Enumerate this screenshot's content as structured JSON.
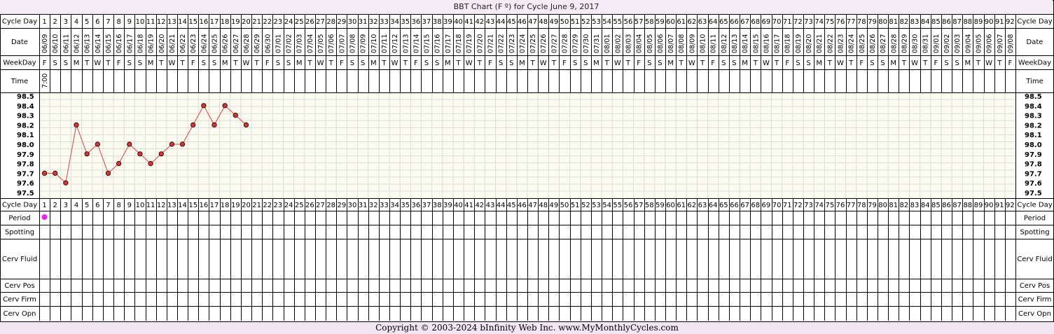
{
  "title": "BBT Chart (F º) for Cycle June 9, 2017",
  "row_labels": {
    "cycle_day": "Cycle Day",
    "date": "Date",
    "weekday": "WeekDay",
    "time": "Time",
    "period": "Period",
    "spotting": "Spotting",
    "cerv_fluid": "Cerv Fluid",
    "cerv_pos": "Cerv Pos",
    "cerv_firm": "Cerv Firm",
    "cerv_opn": "Cerv Opn"
  },
  "days": [
    "1",
    "2",
    "3",
    "4",
    "5",
    "6",
    "7",
    "8",
    "9",
    "10",
    "11",
    "12",
    "13",
    "14",
    "15",
    "16",
    "17",
    "18",
    "19",
    "20",
    "21",
    "22",
    "23",
    "24",
    "25",
    "26",
    "27",
    "28",
    "29",
    "30",
    "31",
    "32",
    "33",
    "34",
    "35",
    "36",
    "37",
    "38",
    "39",
    "40",
    "41",
    "42",
    "43",
    "44",
    "45",
    "46",
    "47",
    "48",
    "49",
    "50",
    "51",
    "52",
    "53",
    "54",
    "55",
    "56",
    "57",
    "58",
    "59",
    "60",
    "61",
    "62",
    "63",
    "64",
    "65",
    "66",
    "67",
    "68",
    "69",
    "70",
    "71",
    "72",
    "73",
    "74",
    "75",
    "76",
    "77",
    "78",
    "79",
    "80",
    "81",
    "82",
    "83",
    "84",
    "85",
    "86",
    "87",
    "88",
    "89",
    "90",
    "91",
    "92"
  ],
  "dates": [
    "06/09",
    "06/10",
    "06/11",
    "06/12",
    "06/13",
    "06/14",
    "06/15",
    "06/16",
    "06/17",
    "06/18",
    "06/19",
    "06/20",
    "06/21",
    "06/22",
    "06/23",
    "06/24",
    "06/25",
    "06/26",
    "06/27",
    "06/28",
    "06/29",
    "06/30",
    "07/01",
    "07/02",
    "07/03",
    "07/04",
    "07/05",
    "07/06",
    "07/07",
    "07/08",
    "07/09",
    "07/10",
    "07/11",
    "07/12",
    "07/13",
    "07/14",
    "07/15",
    "07/16",
    "07/17",
    "07/18",
    "07/19",
    "07/20",
    "07/21",
    "07/22",
    "07/23",
    "07/24",
    "07/25",
    "07/26",
    "07/27",
    "07/28",
    "07/29",
    "07/30",
    "07/31",
    "08/01",
    "08/02",
    "08/03",
    "08/04",
    "08/05",
    "08/06",
    "08/07",
    "08/08",
    "08/09",
    "08/10",
    "08/11",
    "08/12",
    "08/13",
    "08/14",
    "08/15",
    "08/16",
    "08/17",
    "08/18",
    "08/19",
    "08/20",
    "08/21",
    "08/22",
    "08/23",
    "08/24",
    "08/25",
    "08/26",
    "08/27",
    "08/28",
    "08/29",
    "08/30",
    "08/31",
    "09/01",
    "09/02",
    "09/03",
    "09/04",
    "09/05",
    "09/06",
    "09/07",
    "09/08"
  ],
  "weekdays": [
    "F",
    "S",
    "S",
    "M",
    "T",
    "W",
    "T",
    "F",
    "S",
    "S",
    "M",
    "T",
    "W",
    "T",
    "F",
    "S",
    "S",
    "M",
    "T",
    "W",
    "T",
    "F",
    "S",
    "S",
    "M",
    "T",
    "W",
    "T",
    "F",
    "S",
    "S",
    "M",
    "T",
    "W",
    "T",
    "F",
    "S",
    "S",
    "M",
    "T",
    "W",
    "T",
    "F",
    "S",
    "S",
    "M",
    "T",
    "W",
    "T",
    "F",
    "S",
    "S",
    "M",
    "T",
    "W",
    "T",
    "F",
    "S",
    "S",
    "M",
    "T",
    "W",
    "T",
    "F",
    "S",
    "S",
    "M",
    "T",
    "W",
    "T",
    "F",
    "S",
    "S",
    "M",
    "T",
    "W",
    "T",
    "F",
    "S",
    "S",
    "M",
    "T",
    "W",
    "T",
    "F",
    "S",
    "S",
    "M",
    "T",
    "W",
    "T",
    "F"
  ],
  "times": [
    "7:00"
  ],
  "chart_data": {
    "type": "line",
    "title": "BBT Chart (F º) for Cycle June 9, 2017",
    "x": [
      1,
      2,
      3,
      4,
      5,
      6,
      7,
      8,
      9,
      10,
      11,
      12,
      13,
      14,
      15,
      16,
      17,
      18,
      19,
      20
    ],
    "y": [
      97.7,
      97.7,
      97.6,
      98.2,
      97.9,
      98.0,
      97.7,
      97.8,
      98.0,
      97.9,
      97.8,
      97.9,
      98.0,
      98.0,
      98.2,
      98.4,
      98.2,
      98.4,
      98.3,
      98.2
    ],
    "y_ticks": [
      "98.5",
      "98.4",
      "98.3",
      "98.2",
      "98.1",
      "98.0",
      "97.9",
      "97.8",
      "97.7",
      "97.6",
      "97.5"
    ],
    "ylim": [
      97.5,
      98.5
    ],
    "xlim": [
      1,
      92
    ],
    "grid": true,
    "line_color": "#e04040",
    "point_color": "#e03030"
  },
  "period_days": [
    1
  ],
  "colors": {
    "period": "#ee22ee",
    "header_bg": "#f6ecf6",
    "plot_bg": "#fbfbef",
    "grid_minor": "#dddddd"
  },
  "copyright": "Copyright © 2003-2024 bInfinity Web Inc.     www.MyMonthlyCycles.com"
}
